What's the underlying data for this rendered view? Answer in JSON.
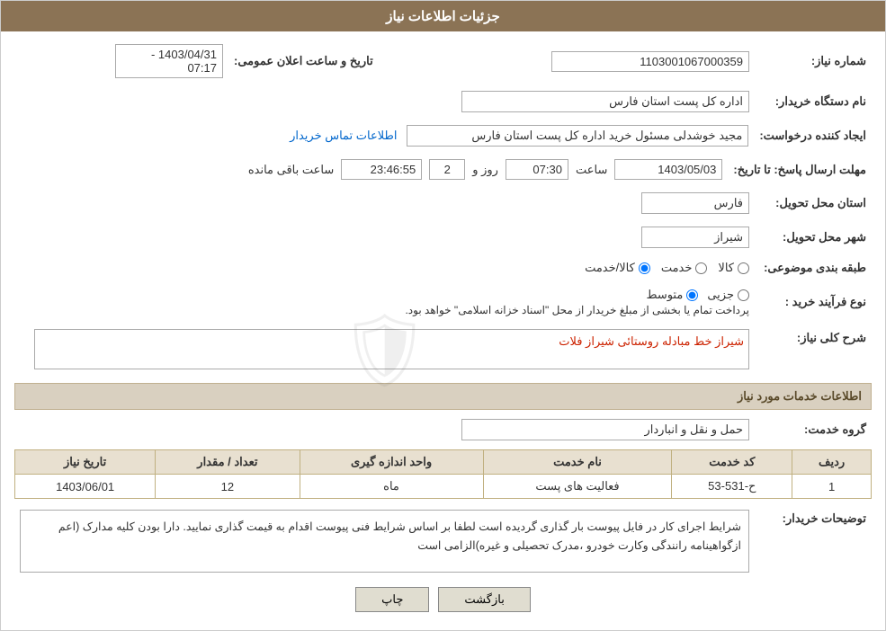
{
  "header": {
    "title": "جزئیات اطلاعات نیاز"
  },
  "fields": {
    "shomareNiaz_label": "شماره نیاز:",
    "shomareNiaz_value": "1103001067000359",
    "namDasgahKharidار_label": "نام دستگاه خریدار:",
    "namDasgahKharidار_value": "اداره کل پست استان فارس",
    "ijadKannandeh_label": "ایجاد کننده درخواست:",
    "ijadKannandeh_value": "مجید خوشدلی مسئول خرید اداره کل پست استان فارس",
    "ijadKannandeh_link": "اطلاعات تماس خریدار",
    "mohlat_label": "مهلت ارسال پاسخ: تا تاریخ:",
    "tarikh_value": "1403/05/03",
    "saat_label": "ساعت",
    "saat_value": "07:30",
    "roz_label": "روز و",
    "roz_value": "2",
    "baqiMandeh_label": "ساعت باقی مانده",
    "baqiMandeh_value": "23:46:55",
    "tarikh_eLan_label": "تاریخ و ساعت اعلان عمومی:",
    "tarikh_eLan_value": "1403/04/31 - 07:17",
    "ostan_label": "استان محل تحویل:",
    "ostan_value": "فارس",
    "shahr_label": "شهر محل تحویل:",
    "shahr_value": "شیراز",
    "tabaqeh_label": "طبقه بندی موضوعی:",
    "tabaqeh_kala": "کالا",
    "tabaqeh_khadamat": "خدمت",
    "tabaqeh_kalaKhadamat": "کالا/خدمت",
    "naveFarayand_label": "نوع فرآیند خرید :",
    "naveFarayand_jazii": "جزیی",
    "naveFarayand_motaset": "متوسط",
    "naveFarayand_note": "پرداخت تمام یا بخشی از مبلغ خریدار از محل \"اسناد خزانه اسلامی\" خواهد بود.",
    "sharh_label": "شرح کلی نیاز:",
    "sharh_value": "شیراز خط مبادله روستائی شیراز فلات",
    "khadamat_section": "اطلاعات خدمات مورد نیاز",
    "gohreKhadamat_label": "گروه خدمت:",
    "gohreKhadamat_value": "حمل و نقل و انباردار",
    "table_headers": [
      "ردیف",
      "کد خدمت",
      "نام خدمت",
      "واحد اندازه گیری",
      "تعداد / مقدار",
      "تاریخ نیاز"
    ],
    "table_rows": [
      {
        "radif": "1",
        "kod": "ح-531-53",
        "nam": "فعالیت های پست",
        "vahed": "ماه",
        "tedad": "12",
        "tarikh": "1403/06/01"
      }
    ],
    "description_label": "توضیحات خریدار:",
    "description_value": "شرایط اجرای کار در فایل پیوست بار گذاری گردیده است لطفا بر اساس شرایط فنی پیوست اقدام به قیمت گذاری نمایید.\nدارا بودن کلیه مدارک (اعم ازگواهینامه رانندگی وکارت خودرو ،مدرک تحصیلی و غیره)الزامی است"
  },
  "buttons": {
    "print_label": "چاپ",
    "back_label": "بازگشت"
  }
}
